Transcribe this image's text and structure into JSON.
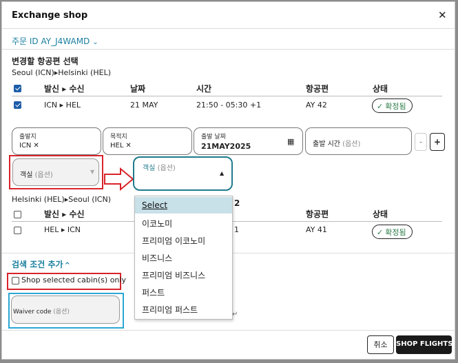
{
  "dialog": {
    "title": "Exchange shop",
    "close_icon": "close-icon"
  },
  "order": {
    "label": "주문 ID AY_J4WAMD"
  },
  "section1": {
    "title": "변경할 항공편 선택",
    "route_from": "Seoul (ICN)",
    "route_to": "Helsinki (HEL)"
  },
  "table_headers": {
    "route": "발신 ▸ 수신",
    "date": "날짜",
    "time": "시간",
    "flight": "항공편",
    "status": "상태"
  },
  "outbound_row": {
    "route": "ICN ▸ HEL",
    "date": "21 MAY",
    "time": "21:50 - 05:30 +1",
    "flight": "AY 42",
    "status": "확정됨"
  },
  "search_fields": {
    "origin_label": "출발지",
    "origin_value": "ICN",
    "destination_label": "목적지",
    "destination_value": "HEL",
    "departure_date_label": "출발 날짜",
    "departure_date_value": "21MAY2025",
    "departure_time_label": "출발 시간",
    "departure_time_placeholder": "(옵션)",
    "minus": "-",
    "plus": "+"
  },
  "cabin_left": {
    "label": "객실",
    "placeholder": "(옵션)"
  },
  "cabin_right": {
    "label": "객실",
    "placeholder": "(옵션)"
  },
  "cabin_options": [
    "Select",
    "이코노미",
    "프리미엄 이코노미",
    "비즈니스",
    "프리미엄 비즈니스",
    "퍼스트",
    "프리미엄 퍼스트"
  ],
  "section2": {
    "route_from": "Helsinki (HEL)",
    "route_to": "Seoul (ICN)",
    "partial_header": "2"
  },
  "return_row": {
    "route": "HEL ▸ ICN",
    "partial_time": "1",
    "flight": "AY 41",
    "status": "확정됨"
  },
  "search_criteria": {
    "label": "검색 조건 추가"
  },
  "shop_selected": {
    "label": "Shop selected cabin(s) only"
  },
  "waiver": {
    "label": "Waiver code",
    "placeholder": "(옵션)"
  },
  "footer": {
    "cancel": "취소",
    "shop_flights": "SHOP FLIGHTS"
  },
  "colors": {
    "accent": "#1a7fa0",
    "highlight_red": "#d8232a",
    "highlight_blue": "#2aa6d3",
    "focus_teal": "#1f7a8c",
    "confirmed_green": "#2f7d4a"
  }
}
